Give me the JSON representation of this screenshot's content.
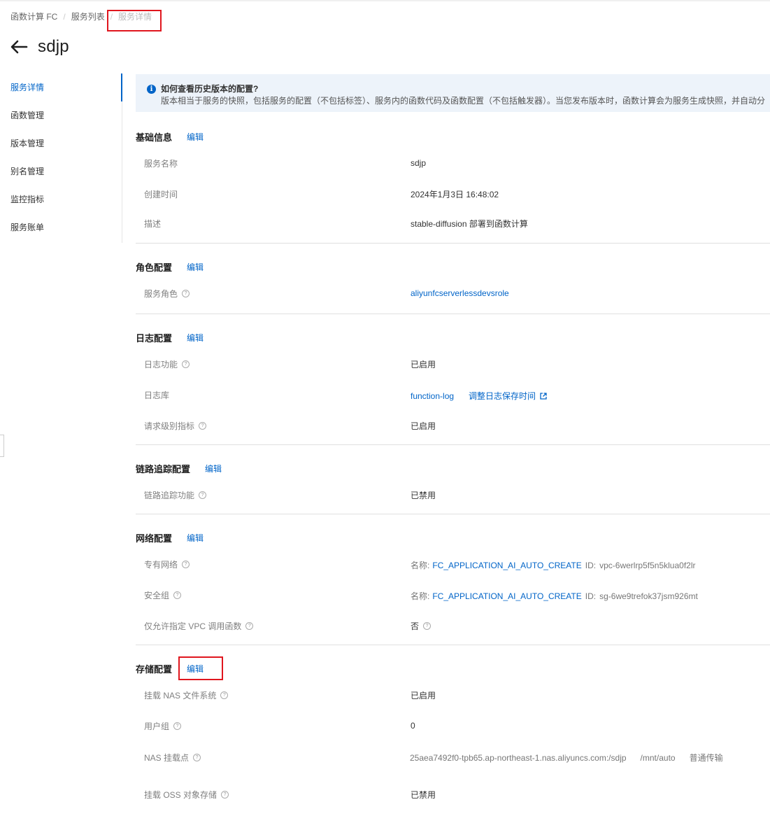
{
  "breadcrumb": {
    "items": [
      "函数计算 FC",
      "服务列表",
      "服务详情"
    ],
    "separator": "/"
  },
  "page": {
    "title": "sdjp"
  },
  "sidebar": {
    "items": [
      "服务详情",
      "函数管理",
      "版本管理",
      "别名管理",
      "监控指标",
      "服务账单"
    ]
  },
  "notice": {
    "title": "如何查看历史版本的配置?",
    "body": "版本相当于服务的快照，包括服务的配置（不包括标签）、服务内的函数代码及函数配置（不包括触发器）。当您发布版本时，函数计算会为服务生成快照，并自动分"
  },
  "sections": {
    "basic": {
      "title": "基础信息",
      "edit": "编辑",
      "rows": [
        {
          "label": "服务名称",
          "value": "sdjp"
        },
        {
          "label": "创建时间",
          "value": "2024年1月3日 16:48:02"
        },
        {
          "label": "描述",
          "value": "stable-diffusion 部署到函数计算"
        }
      ]
    },
    "role": {
      "title": "角色配置",
      "edit": "编辑",
      "rows": [
        {
          "label": "服务角色",
          "value": "aliyunfcserverlessdevsrole"
        }
      ]
    },
    "log": {
      "title": "日志配置",
      "edit": "编辑",
      "rows": [
        {
          "label": "日志功能",
          "value": "已启用"
        },
        {
          "label": "日志库",
          "value": "function-log",
          "action": "调整日志保存时间"
        },
        {
          "label": "请求级别指标",
          "value": "已启用"
        }
      ]
    },
    "trace": {
      "title": "链路追踪配置",
      "edit": "编辑",
      "rows": [
        {
          "label": "链路追踪功能",
          "value": "已禁用"
        }
      ]
    },
    "network": {
      "title": "网络配置",
      "edit": "编辑",
      "rows": [
        {
          "label": "专有网络",
          "name_prefix": "名称:",
          "name": "FC_APPLICATION_AI_AUTO_CREATE",
          "id_prefix": "ID:",
          "id": "vpc-6werlrp5f5n5klua0f2lr"
        },
        {
          "label": "安全组",
          "name_prefix": "名称:",
          "name": "FC_APPLICATION_AI_AUTO_CREATE",
          "id_prefix": "ID:",
          "id": "sg-6we9trefok37jsm926mt"
        },
        {
          "label": "仅允许指定 VPC 调用函数",
          "value": "否"
        }
      ]
    },
    "storage": {
      "title": "存储配置",
      "edit": "编辑",
      "rows": [
        {
          "label": "挂载 NAS 文件系统",
          "value": "已启用"
        },
        {
          "label": "用户组",
          "value": "0"
        },
        {
          "label": "NAS 挂载点",
          "server": "25aea7492f0-tpb65.ap-northeast-1.nas.aliyuncs.com:/sdjp",
          "mount": "/mnt/auto",
          "mode": "普通传输"
        },
        {
          "label": "挂载 OSS 对象存储",
          "value": "已禁用"
        }
      ]
    }
  },
  "colors": {
    "accent": "#0064c8",
    "highlight": "#e0161e"
  }
}
